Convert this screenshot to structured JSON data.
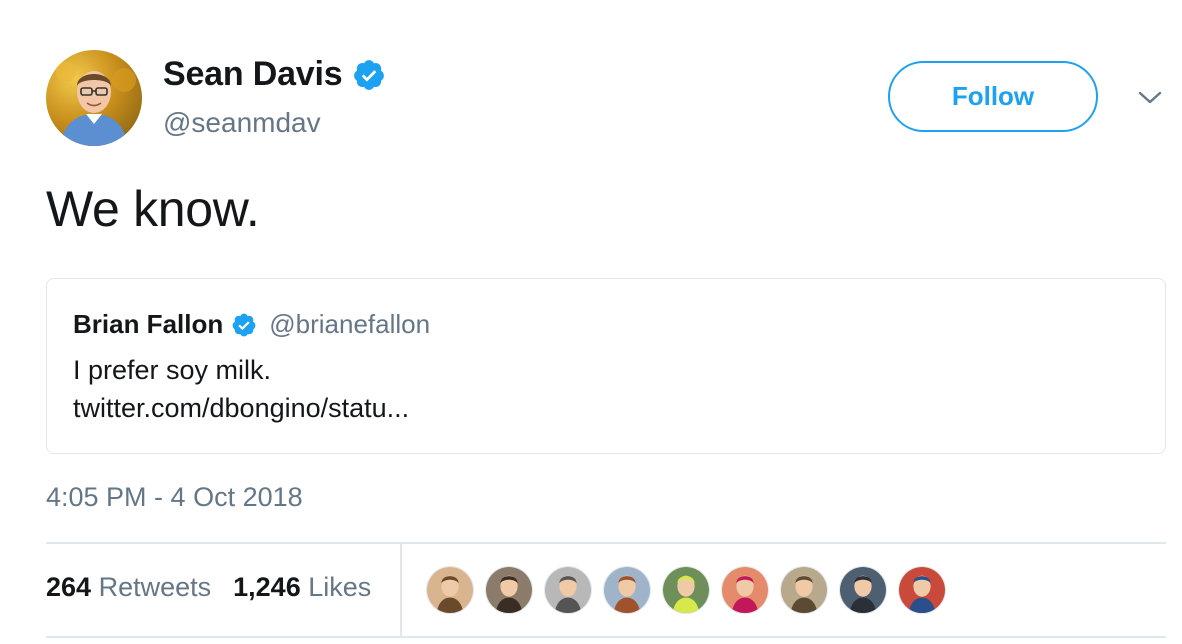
{
  "author": {
    "name": "Sean Davis",
    "handle": "@seanmdav",
    "verified": true,
    "avatar_icon": "profile-photo-icon"
  },
  "follow_button": {
    "label": "Follow"
  },
  "menu": {
    "icon": "chevron-down-icon"
  },
  "tweet": {
    "text": "We know."
  },
  "quoted_tweet": {
    "name": "Brian Fallon",
    "handle": "@brianefallon",
    "verified": true,
    "text": "I prefer soy milk.",
    "link": "twitter.com/dbongino/statu..."
  },
  "timestamp": "4:05 PM - 4 Oct 2018",
  "stats": {
    "retweets_count": "264",
    "retweets_label": "Retweets",
    "likes_count": "1,246",
    "likes_label": "Likes"
  },
  "likers": [
    {
      "icon": "liker-avatar-icon",
      "bg": "#d9b48f",
      "fg": "#6b4a2b"
    },
    {
      "icon": "liker-avatar-icon",
      "bg": "#8a7b6a",
      "fg": "#3a2e24"
    },
    {
      "icon": "liker-avatar-icon",
      "bg": "#b8b8b8",
      "fg": "#555555"
    },
    {
      "icon": "liker-avatar-icon",
      "bg": "#9fb4c9",
      "fg": "#a0522d"
    },
    {
      "icon": "liker-avatar-icon",
      "bg": "#6f8f5a",
      "fg": "#d7e84a"
    },
    {
      "icon": "liker-avatar-icon",
      "bg": "#e58a6a",
      "fg": "#c2185b"
    },
    {
      "icon": "liker-avatar-icon",
      "bg": "#b9a98c",
      "fg": "#5c4a32"
    },
    {
      "icon": "liker-avatar-icon",
      "bg": "#4f5f72",
      "fg": "#2a2f38"
    },
    {
      "icon": "liker-avatar-icon",
      "bg": "#c94a3a",
      "fg": "#2b4f8a"
    }
  ],
  "colors": {
    "accent": "#1da1f2",
    "text": "#14171a",
    "muted": "#657786",
    "border": "#e1e8ed"
  }
}
